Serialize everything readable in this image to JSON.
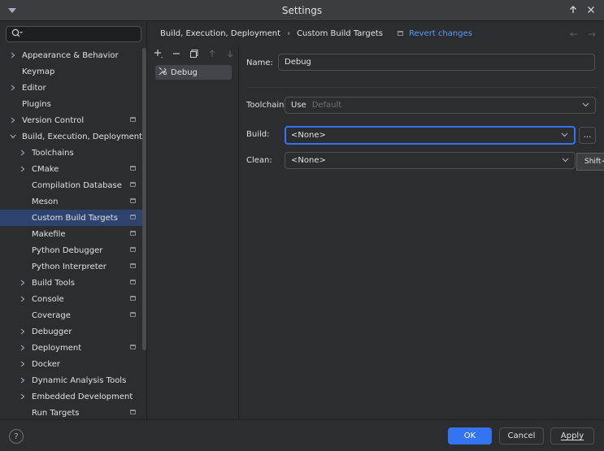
{
  "window": {
    "title": "Settings"
  },
  "search": {
    "placeholder": "",
    "icon": "search-icon"
  },
  "sidebar": {
    "items": [
      {
        "label": "Appearance & Behavior",
        "level": 0,
        "expandable": true,
        "expanded": false,
        "marker": false
      },
      {
        "label": "Keymap",
        "level": 0,
        "expandable": false,
        "marker": false
      },
      {
        "label": "Editor",
        "level": 0,
        "expandable": true,
        "expanded": false,
        "marker": false
      },
      {
        "label": "Plugins",
        "level": 0,
        "expandable": false,
        "marker": false
      },
      {
        "label": "Version Control",
        "level": 0,
        "expandable": true,
        "expanded": false,
        "marker": true
      },
      {
        "label": "Build, Execution, Deployment",
        "level": 0,
        "expandable": true,
        "expanded": true,
        "marker": false
      },
      {
        "label": "Toolchains",
        "level": 1,
        "expandable": true,
        "expanded": false,
        "marker": false
      },
      {
        "label": "CMake",
        "level": 1,
        "expandable": true,
        "expanded": false,
        "marker": true
      },
      {
        "label": "Compilation Database",
        "level": 1,
        "expandable": false,
        "marker": true
      },
      {
        "label": "Meson",
        "level": 1,
        "expandable": false,
        "marker": true
      },
      {
        "label": "Custom Build Targets",
        "level": 1,
        "expandable": false,
        "marker": true,
        "selected": true
      },
      {
        "label": "Makefile",
        "level": 1,
        "expandable": false,
        "marker": true
      },
      {
        "label": "Python Debugger",
        "level": 1,
        "expandable": false,
        "marker": true
      },
      {
        "label": "Python Interpreter",
        "level": 1,
        "expandable": false,
        "marker": true
      },
      {
        "label": "Build Tools",
        "level": 1,
        "expandable": true,
        "expanded": false,
        "marker": true
      },
      {
        "label": "Console",
        "level": 1,
        "expandable": true,
        "expanded": false,
        "marker": true
      },
      {
        "label": "Coverage",
        "level": 1,
        "expandable": false,
        "marker": true
      },
      {
        "label": "Debugger",
        "level": 1,
        "expandable": true,
        "expanded": false,
        "marker": false
      },
      {
        "label": "Deployment",
        "level": 1,
        "expandable": true,
        "expanded": false,
        "marker": true
      },
      {
        "label": "Docker",
        "level": 1,
        "expandable": true,
        "expanded": false,
        "marker": false
      },
      {
        "label": "Dynamic Analysis Tools",
        "level": 1,
        "expandable": true,
        "expanded": false,
        "marker": false
      },
      {
        "label": "Embedded Development",
        "level": 1,
        "expandable": true,
        "expanded": false,
        "marker": false
      },
      {
        "label": "Run Targets",
        "level": 1,
        "expandable": false,
        "marker": true
      }
    ]
  },
  "breadcrumb": {
    "parent": "Build, Execution, Deployment",
    "current": "Custom Build Targets",
    "revert_label": "Revert changes"
  },
  "targets": {
    "items": [
      {
        "label": "Debug"
      }
    ]
  },
  "form": {
    "name_label": "Name:",
    "name_value": "Debug",
    "toolchain_label": "Toolchain:",
    "toolchain_use": "Use",
    "toolchain_value": "Default",
    "build_label": "Build:",
    "build_value": "<None>",
    "clean_label": "Clean:",
    "clean_value": "<None>",
    "ellipsis_label": "...",
    "tooltip_text": "Shift+"
  },
  "footer": {
    "help_label": "?",
    "ok_label": "OK",
    "cancel_label": "Cancel",
    "apply_label": "Apply"
  },
  "colors": {
    "accent": "#3574f0",
    "link": "#589df6",
    "selection": "#2e436e",
    "background": "#2b2d30"
  }
}
